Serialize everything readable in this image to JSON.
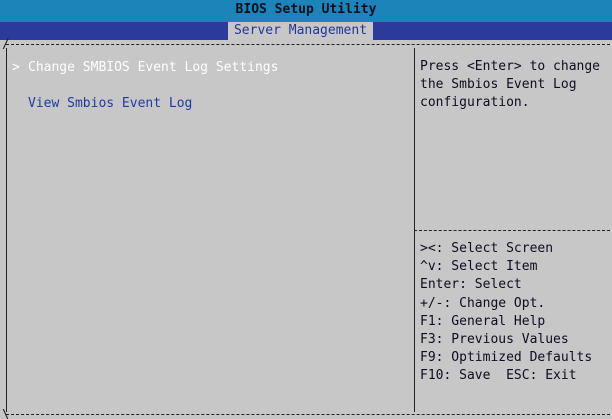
{
  "window": {
    "title": "BIOS Setup Utility"
  },
  "menu": {
    "active_tab": "Server Management"
  },
  "items": [
    {
      "label": "Change SMBIOS Event Log Settings",
      "selected": true
    },
    {
      "label": "View Smbios Event Log",
      "selected": false
    }
  ],
  "selection_marker": ">",
  "help": {
    "lines": [
      "Press <Enter> to change",
      "the Smbios Event Log",
      "configuration."
    ]
  },
  "keys": [
    "><: Select Screen",
    "^v: Select Item",
    "Enter: Select",
    "+/-: Change Opt.",
    "F1: General Help",
    "F3: Previous Values",
    "F9: Optimized Defaults",
    "F10: Save  ESC: Exit"
  ],
  "colors": {
    "title_bar": "#1c84b8",
    "menu_bar": "#2c3a9c",
    "background": "#c7c7c7",
    "selected_text": "#ffffff",
    "item_text": "#1f3ba0"
  }
}
